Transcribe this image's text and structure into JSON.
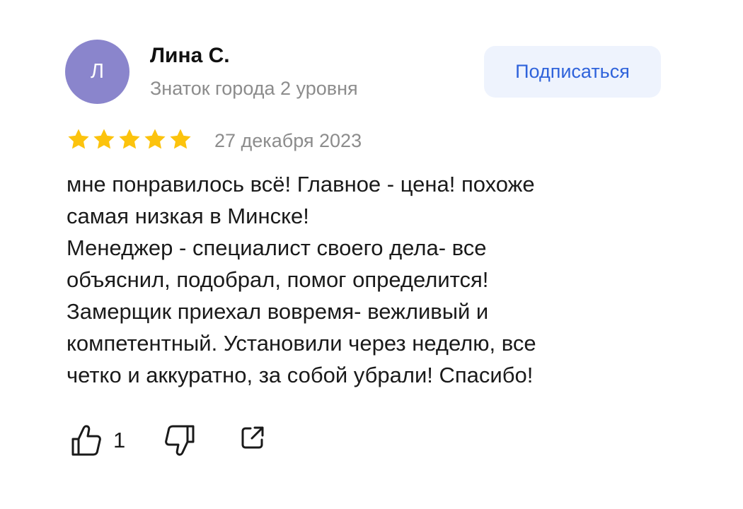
{
  "author": {
    "avatar_letter": "Л",
    "avatar_color": "#8a85cc",
    "name": "Лина С.",
    "level": "Знаток города 2 уровня"
  },
  "subscribe": {
    "label": "Подписаться",
    "text_color": "#2f63db",
    "bg_color": "#eef3fd"
  },
  "rating": {
    "stars": 5,
    "max": 5,
    "star_color": "#fcc30d"
  },
  "review": {
    "date": "27 декабря 2023",
    "lines": [
      "мне понравилось всё! Главное - цена! похоже",
      "самая низкая в Минске!",
      "Менеджер - специалист своего дела- все",
      "объяснил, подобрал, помог определится!",
      "Замерщик приехал вовремя- вежливый и",
      "компетентный. Установили через неделю, все",
      "четко и аккуратно, за собой убрали! Спасибо!"
    ]
  },
  "actions": {
    "like_icon": "thumbs-up-icon",
    "like_count": "1",
    "dislike_icon": "thumbs-down-icon",
    "share_icon": "share-icon"
  }
}
